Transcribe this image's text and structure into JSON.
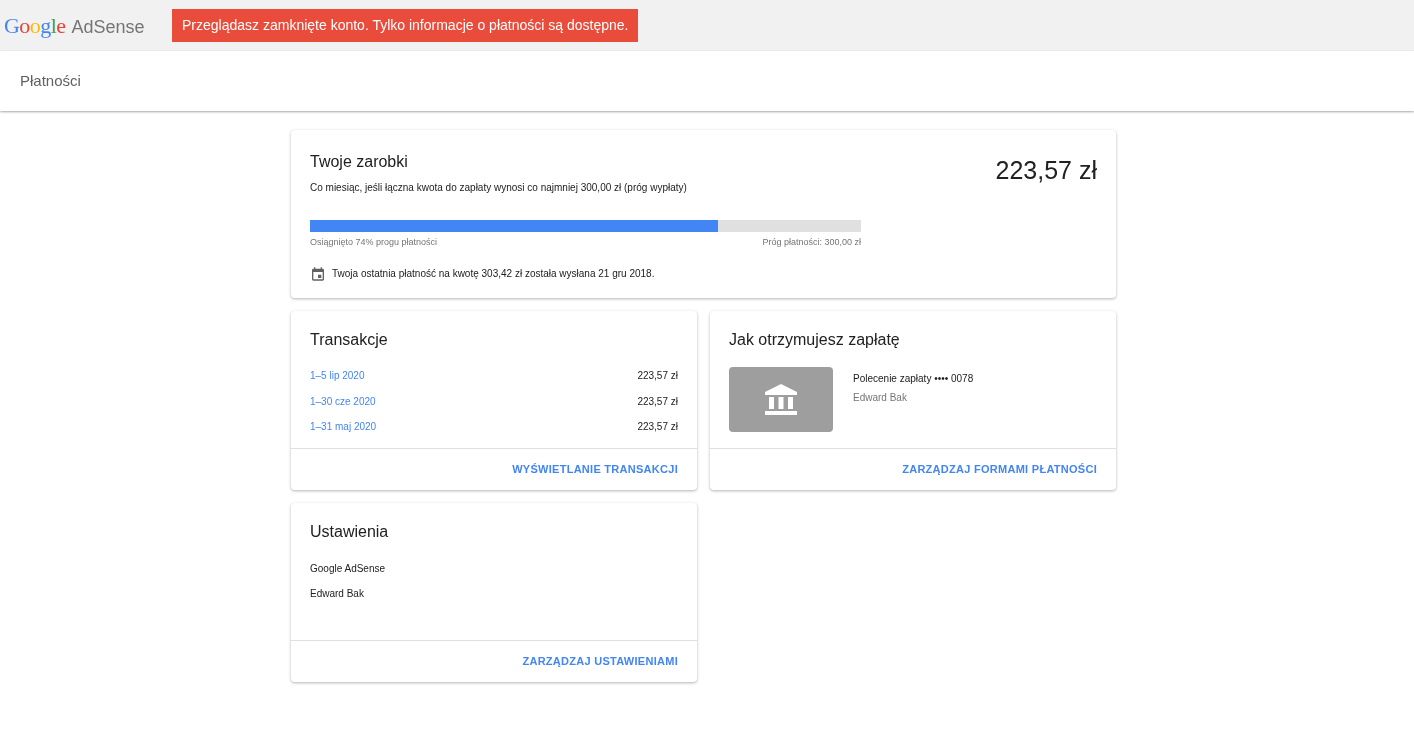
{
  "header": {
    "logo_google": "Google",
    "logo_product": "AdSense",
    "alert": "Przeglądasz zamknięte konto. Tylko informacje o płatności są dostępne."
  },
  "page_title": "Płatności",
  "earnings": {
    "title": "Twoje zarobki",
    "subtitle": "Co miesiąc, jeśli łączna kwota do zapłaty wynosi co najmniej 300,00 zł (próg wypłaty)",
    "amount": "223,57 zł",
    "level": 0.74,
    "progress_label": "Osiągnięto 74% progu płatności",
    "threshold_label": "Próg płatności: 300,00 zł",
    "last_payment": "Twoja ostatnia płatność na kwotę 303,42 zł została wysłana 21 gru 2018."
  },
  "transactions": {
    "title": "Transakcje",
    "rows": [
      {
        "period": "1–5 lip 2020",
        "amount": "223,57 zł"
      },
      {
        "period": "1–30 cze 2020",
        "amount": "223,57 zł"
      },
      {
        "period": "1–31 maj 2020",
        "amount": "223,57 zł"
      }
    ],
    "action": "WYŚWIETLANIE TRANSAKCJI"
  },
  "payment_method": {
    "title": "Jak otrzymujesz zapłatę",
    "method": "Polecenie zapłaty",
    "masked": "•••• 0078",
    "holder": "Edward Bak",
    "action": "ZARZĄDZAJ FORMAMI PŁATNOŚCI"
  },
  "settings": {
    "title": "Ustawienia",
    "lines": [
      "Google AdSense",
      "Edward Bak"
    ],
    "action": "ZARZĄDZAJ USTAWIENIAMI"
  }
}
